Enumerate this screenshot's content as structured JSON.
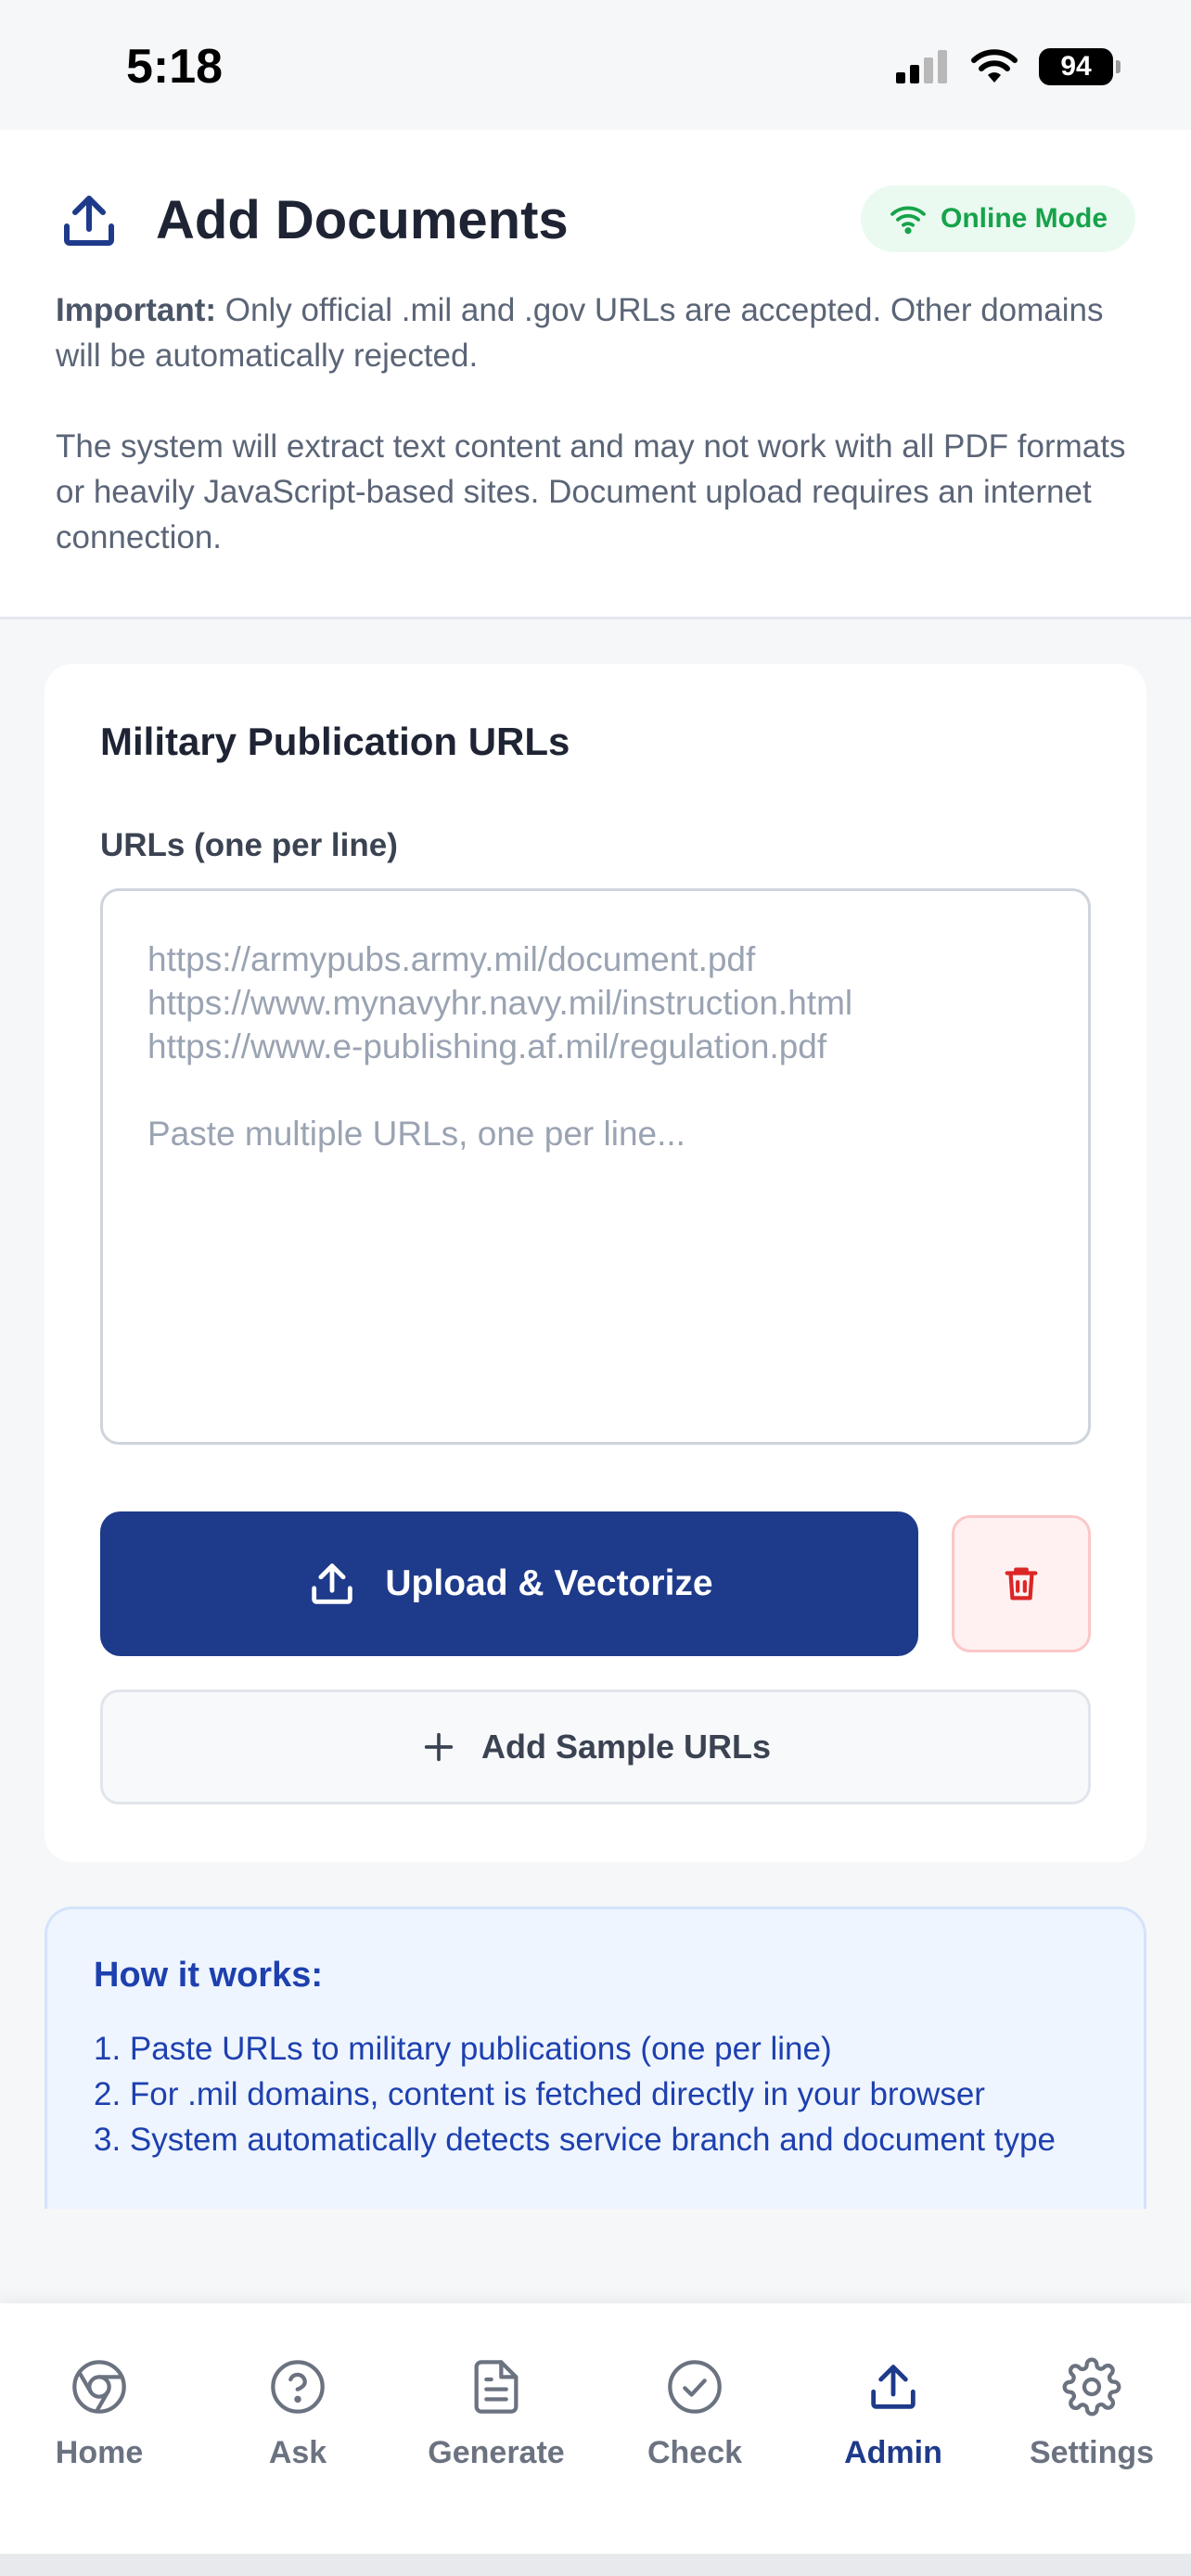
{
  "status_bar": {
    "time": "5:18",
    "battery": "94"
  },
  "header": {
    "title": "Add Documents",
    "mode_badge": "Online Mode",
    "important_label": "Important:",
    "important_text": " Only official .mil and .gov URLs are accepted. Other domains will be automatically rejected.",
    "note_text": "The system will extract text content and may not work with all PDF formats or heavily JavaScript-based sites. Document upload requires an internet connection."
  },
  "form": {
    "card_title": "Military Publication URLs",
    "urls_label": "URLs (one per line)",
    "urls_value": "",
    "urls_placeholder": "https://armypubs.army.mil/document.pdf\nhttps://www.mynavyhr.navy.mil/instruction.html\nhttps://www.e-publishing.af.mil/regulation.pdf\n\nPaste multiple URLs, one per line...",
    "upload_label": "Upload & Vectorize",
    "add_sample_label": "Add Sample URLs"
  },
  "info": {
    "title": "How it works:",
    "steps": [
      "1. Paste URLs to military publications (one per line)",
      "2. For .mil domains, content is fetched directly in your browser",
      "3. System automatically detects service branch and document type"
    ]
  },
  "nav": {
    "items": [
      {
        "label": "Home",
        "icon": "chrome-icon"
      },
      {
        "label": "Ask",
        "icon": "help-circle-icon"
      },
      {
        "label": "Generate",
        "icon": "document-icon"
      },
      {
        "label": "Check",
        "icon": "check-circle-icon"
      },
      {
        "label": "Admin",
        "icon": "upload-icon"
      },
      {
        "label": "Settings",
        "icon": "gear-icon"
      }
    ],
    "active": "Admin"
  },
  "colors": {
    "primary": "#1e3a8a",
    "online_green": "#16a34a",
    "danger": "#dc2626",
    "info_blue": "#1e40af"
  }
}
